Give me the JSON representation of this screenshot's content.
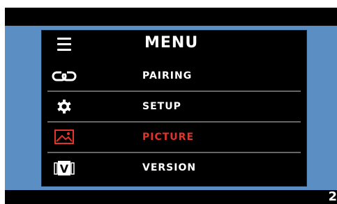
{
  "menu": {
    "title": "MENU",
    "items": [
      {
        "label": "PAIRING",
        "icon": "pairing-link-icon",
        "active": false
      },
      {
        "label": "SETUP",
        "icon": "gear-icon",
        "active": false
      },
      {
        "label": "PICTURE",
        "icon": "picture-icon",
        "active": true
      },
      {
        "label": "VERSION",
        "icon": "version-icon",
        "active": false
      }
    ]
  },
  "corner_glyph": "2",
  "colors": {
    "accent": "#e1342a",
    "background_blue": "#5b8fc4",
    "panel": "#000000"
  }
}
